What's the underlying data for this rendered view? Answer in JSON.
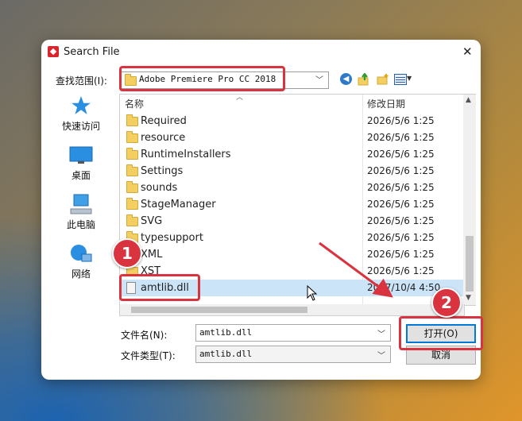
{
  "dialog": {
    "title": "Search File",
    "close_label": "✕"
  },
  "lookin": {
    "label": "查找范围(I):",
    "value": "Adobe Premiere Pro CC 2018"
  },
  "toolbar": {
    "back_icon": "back-arrow-icon",
    "up_icon": "up-folder-icon",
    "new_folder_icon": "new-folder-icon",
    "view_menu_icon": "view-menu-icon"
  },
  "places": [
    {
      "label": "快速访问",
      "icon": "star-icon"
    },
    {
      "label": "桌面",
      "icon": "desktop-icon"
    },
    {
      "label": "此电脑",
      "icon": "computer-icon"
    },
    {
      "label": "网络",
      "icon": "network-icon"
    }
  ],
  "columns": {
    "name": "名称",
    "modified": "修改日期"
  },
  "files": [
    {
      "name": "Required",
      "date": "2026/5/6 1:25",
      "type": "folder"
    },
    {
      "name": "resource",
      "date": "2026/5/6 1:25",
      "type": "folder"
    },
    {
      "name": "RuntimeInstallers",
      "date": "2026/5/6 1:25",
      "type": "folder"
    },
    {
      "name": "Settings",
      "date": "2026/5/6 1:25",
      "type": "folder"
    },
    {
      "name": "sounds",
      "date": "2026/5/6 1:25",
      "type": "folder"
    },
    {
      "name": "StageManager",
      "date": "2026/5/6 1:25",
      "type": "folder"
    },
    {
      "name": "SVG",
      "date": "2026/5/6 1:25",
      "type": "folder"
    },
    {
      "name": "typesupport",
      "date": "2026/5/6 1:25",
      "type": "folder"
    },
    {
      "name": "XML",
      "date": "2026/5/6 1:25",
      "type": "folder"
    },
    {
      "name": "XST",
      "date": "2026/5/6 1:25",
      "type": "folder"
    },
    {
      "name": "amtlib.dll",
      "date": "2017/10/4 4:50",
      "type": "file",
      "selected": true
    }
  ],
  "filename": {
    "label": "文件名(N):",
    "value": "amtlib.dll"
  },
  "filetype": {
    "label": "文件类型(T):",
    "value": "amtlib.dll"
  },
  "buttons": {
    "open": "打开(O)",
    "cancel": "取消"
  },
  "annotations": {
    "badge1": "1",
    "badge2": "2",
    "highlight_color": "#d9333f"
  }
}
